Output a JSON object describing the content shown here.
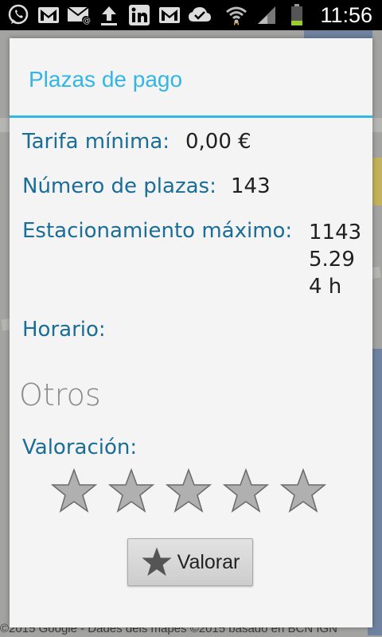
{
  "status_bar": {
    "time": "11:56",
    "notification_icons": [
      "whatsapp-icon",
      "gmail-icon",
      "email-icon",
      "upload-icon",
      "linkedin-icon",
      "gmail-icon",
      "sync-done-icon"
    ],
    "system_icons": [
      "wifi-icon",
      "signal-icon",
      "battery-icon"
    ]
  },
  "map": {
    "attribution": "©2015 Google - Dades dels mapes ©2015 basado en BCN IGN"
  },
  "dialog": {
    "title": "Plazas de pago",
    "rows": [
      {
        "label": "Tarifa mínima:",
        "value": "0,00 €"
      },
      {
        "label": "Número de plazas:",
        "value": "143"
      },
      {
        "label": "Estacionamiento máximo:",
        "values": [
          "1143",
          "5.29",
          "4 h"
        ]
      },
      {
        "label": "Horario:",
        "value": ""
      }
    ],
    "section_title": "Otros",
    "rating": {
      "label": "Valoración:",
      "stars_total": 5,
      "stars_selected": 0
    },
    "rate_button": {
      "label": "Valorar",
      "icon": "star-icon"
    }
  },
  "colors": {
    "accent": "#33b5e5",
    "label_blue": "#1a6d96",
    "star_fill": "#b0b0b0",
    "star_stroke": "#6a6a6a"
  }
}
